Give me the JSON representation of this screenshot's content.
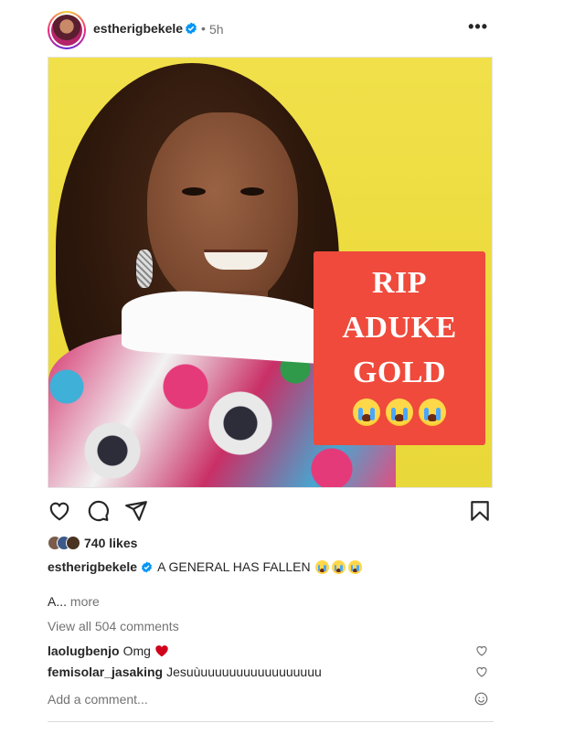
{
  "post": {
    "username": "estherigbekele",
    "separator": "•",
    "time": "5h",
    "more_icon": "more-horizontal-icon",
    "image": {
      "banner_lines": [
        "RIP",
        "ADUKE",
        "GOLD"
      ],
      "emoji_count": 3
    },
    "likes": "740 likes",
    "caption": {
      "username": "estherigbekele",
      "text": "A GENERAL HAS FALLEN"
    },
    "truncated_text": "A...",
    "more_label": "more",
    "view_all": "View all 504 comments",
    "comments": [
      {
        "username": "laolugbenjo",
        "text": "Omg",
        "has_heart": true
      },
      {
        "username": "femisolar_jasaking",
        "text": "Jesuùuuuuuuuuuuuuuuuuu",
        "has_heart": false
      }
    ],
    "add_comment_placeholder": "Add a comment..."
  },
  "colors": {
    "verified": "#0095f6",
    "banner": "#ef4a3b",
    "background": "#e9d83a",
    "heart": "#d0021b"
  }
}
